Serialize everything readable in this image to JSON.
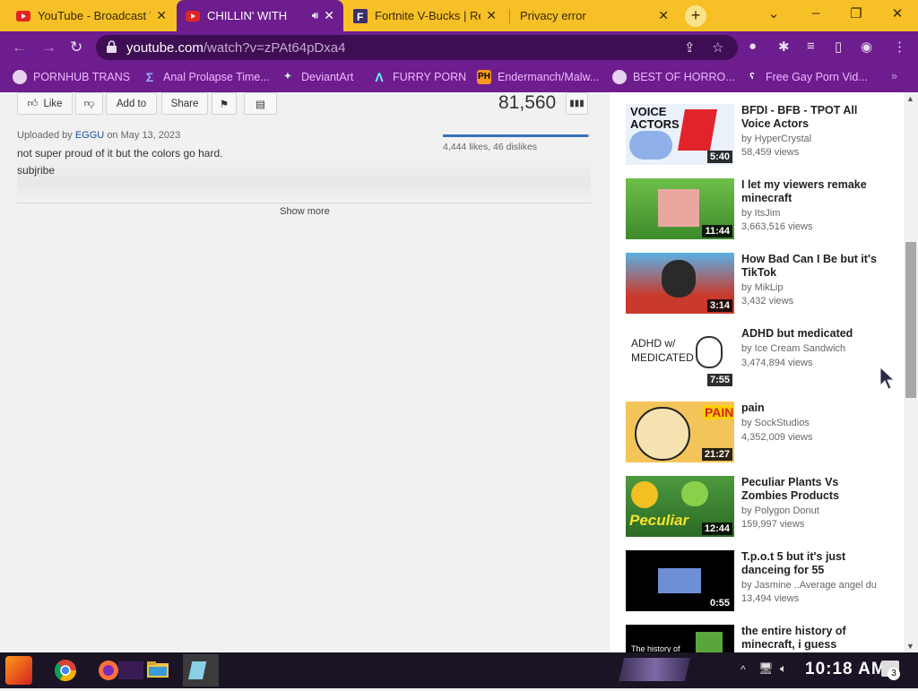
{
  "tabs": [
    {
      "title": "YouTube - Broadcast Yourself",
      "favicon": "youtube-icon"
    },
    {
      "title": "CHILLIN' WITH",
      "favicon": "youtube-icon",
      "active": true,
      "audio": true
    },
    {
      "title": "Fortnite V-Bucks | Re",
      "favicon": "fortnite-icon"
    },
    {
      "title": "Privacy error",
      "favicon": "none"
    }
  ],
  "newtab_label": "+",
  "window": {
    "min": "–",
    "restore": "❐",
    "close": "✕",
    "down": "⌄"
  },
  "address": {
    "host": "youtube.com",
    "path": "/watch?v=zPAt64pDxa4"
  },
  "bookmarks": [
    {
      "label": "PORNHUB TRANS",
      "icon": "globe-icon"
    },
    {
      "label": "Anal Prolapse Time...",
      "icon": "sigma-icon"
    },
    {
      "label": "DeviantArt",
      "icon": "deviantart-icon"
    },
    {
      "label": "FURRY PORN",
      "icon": "a-logo-icon"
    },
    {
      "label": "Endermanch/Malw...",
      "icon": "ph-icon",
      "badge": "PH"
    },
    {
      "label": "BEST OF HORRO...",
      "icon": "globe-icon"
    },
    {
      "label": "Free Gay Porn Vid...",
      "icon": "bear-icon"
    }
  ],
  "video": {
    "like_label": "Like",
    "addto_label": "Add to",
    "share_label": "Share",
    "views": "81,560",
    "likes_text": "4,444 likes, 46 dislikes",
    "like_ratio": 0.99,
    "uploaded_prefix": "Uploaded by",
    "uploader": "EGGU",
    "upload_date": "on May 13, 2023",
    "description_lines": [
      "not super proud of it but the colors go hard.",
      "subjribe"
    ],
    "show_more": "Show more"
  },
  "related": [
    {
      "title": "BFDI - BFB - TPOT All Voice Actors",
      "by": "by HyperCrystal",
      "views": "58,459 views",
      "duration": "5:40",
      "thumb_text": "VOICE ACTORS",
      "thumb_bg": "#e8f0ff"
    },
    {
      "title": "I let my viewers remake minecraft",
      "by": "by ItsJim",
      "views": "3,663,516 views",
      "duration": "11:44",
      "thumb_bg": "#5aa63a"
    },
    {
      "title": "How Bad Can I Be but it's TikTok",
      "by": "by MikLip",
      "views": "3,432 views",
      "duration": "3:14",
      "thumb_bg": "#c9413a"
    },
    {
      "title": "ADHD but medicated",
      "by": "by Ice Cream Sandwich",
      "views": "3,474,894 views",
      "duration": "7:55",
      "thumb_text": "ADHD w/ MEDICATED",
      "thumb_bg": "#ffffff"
    },
    {
      "title": "pain",
      "by": "by SockStudios",
      "views": "4,352,009 views",
      "duration": "21:27",
      "thumb_text": "PAIN",
      "thumb_bg": "#f2c45a"
    },
    {
      "title": "Peculiar Plants Vs Zombies Products",
      "by": "by Polygon Donut",
      "views": "159,997 views",
      "duration": "12:44",
      "thumb_text": "Peculiar",
      "thumb_bg": "#3f8a33"
    },
    {
      "title": "T.p.o.t 5 but it's just danceing for 55",
      "by": "by Jasmine ..Average angel du",
      "views": "13,494 views",
      "duration": "0:55",
      "thumb_bg": "#000000"
    },
    {
      "title": "the entire history of minecraft, i guess",
      "by": "",
      "views": "",
      "duration": "",
      "thumb_text": "The history of",
      "thumb_bg": "#000000"
    }
  ],
  "taskbar": {
    "clock": "10:18 AM",
    "notif_count": "3"
  }
}
